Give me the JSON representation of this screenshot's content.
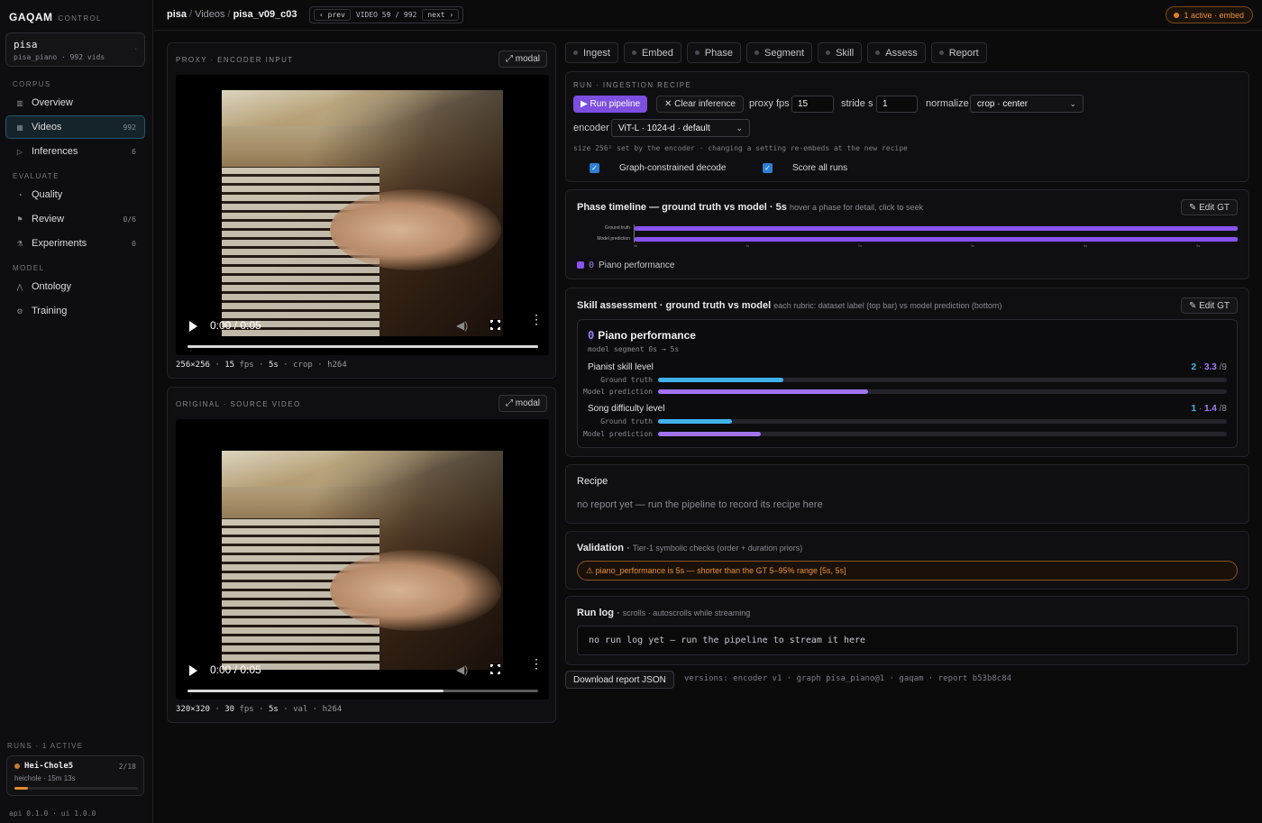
{
  "app": {
    "brand": "GAQAM",
    "brand_sub": "CONTROL"
  },
  "project": {
    "name": "pisa",
    "sub": "pisa_piano · 992 vids",
    "menu_glyph": "·"
  },
  "sidebar": {
    "sections": [
      {
        "title": "CORPUS",
        "items": [
          {
            "label": "Overview",
            "icon": "▥",
            "count": ""
          },
          {
            "label": "Videos",
            "icon": "▦",
            "count": "992"
          },
          {
            "label": "Inferences",
            "icon": "▷",
            "count": "6"
          }
        ]
      },
      {
        "title": "EVALUATE",
        "items": [
          {
            "label": "Quality",
            "icon": "◔",
            "count": ""
          },
          {
            "label": "Review",
            "icon": "⚑",
            "count": "0/6"
          },
          {
            "label": "Experiments",
            "icon": "⚗",
            "count": "0"
          }
        ]
      },
      {
        "title": "MODEL",
        "items": [
          {
            "label": "Ontology",
            "icon": "⋀",
            "count": ""
          },
          {
            "label": "Training",
            "icon": "⚙",
            "count": ""
          }
        ]
      }
    ],
    "active_item": "Videos"
  },
  "runs": {
    "title": "RUNS · 1 ACTIVE",
    "items": [
      {
        "name": "Hei-Chole5",
        "count": "2/18",
        "sub": "heichole · 15m 13s",
        "progress": 0.11
      }
    ]
  },
  "footer": {
    "versions": "api 0.1.0 · ui 1.0.0"
  },
  "header": {
    "crumb_root": "pisa",
    "crumb_mid": "Videos",
    "crumb_leaf": "pisa_v09_c03",
    "prev": "‹ prev",
    "position": "VIDEO 59 / 992",
    "next": "next ›",
    "active_badge": "1 active · embed"
  },
  "proxy": {
    "title": "PROXY · ENCODER INPUT",
    "modal": "⤢ modal",
    "time": "0:00 / 0:05",
    "progress": 1.0,
    "meta": {
      "res": "256×256",
      "fps": "15",
      "fps_unit": "fps",
      "dur": "5s",
      "mode": "crop",
      "codec": "h264"
    }
  },
  "original": {
    "title": "ORIGINAL · SOURCE VIDEO",
    "modal": "⤢ modal",
    "time": "0:00 / 0:05",
    "progress": 0.73,
    "meta": {
      "res": "320×320",
      "fps": "30",
      "fps_unit": "fps",
      "dur": "5s",
      "mode": "val",
      "codec": "h264"
    }
  },
  "tabs": [
    "Ingest",
    "Embed",
    "Phase",
    "Segment",
    "Skill",
    "Assess",
    "Report"
  ],
  "recipe": {
    "title": "RUN · INGESTION RECIPE",
    "run_btn": "▶ Run pipeline",
    "clear_btn": "✕ Clear inference",
    "proxy_fps_label": "proxy fps",
    "proxy_fps": "15",
    "stride_label": "stride s",
    "stride": "1",
    "normalize_label": "normalize",
    "normalize": "crop · center",
    "encoder_label": "encoder",
    "encoder": "ViT-L · 1024-d · default",
    "hint": "size 256² set by the encoder · changing a setting re-embeds at the new recipe",
    "check1": "Graph-constrained decode",
    "check2": "Score all runs"
  },
  "timeline": {
    "title": "Phase timeline — ground truth vs model · 5s",
    "note": "hover a phase for detail, click to seek",
    "edit": "✎ Edit GT",
    "rows": [
      "Ground truth",
      "Model prediction"
    ],
    "ticks": [
      "0s",
      "1s",
      "2s",
      "3s",
      "4s",
      "5s"
    ],
    "legend_idx": "0",
    "legend_label": "Piano performance"
  },
  "skill": {
    "title": "Skill assessment · ground truth vs model",
    "note": "each rubric: dataset label (top bar) vs model prediction (bottom)",
    "edit": "✎ Edit GT",
    "idx": "0",
    "name": "Piano performance",
    "segment": "model segment 0s → 5s",
    "gt_label": "Ground truth",
    "pred_label": "Model prediction",
    "rubrics": [
      {
        "name": "Pianist skill level",
        "gt": "2",
        "pred": "3.3",
        "max": "/9",
        "gt_frac": 0.22,
        "pred_frac": 0.37
      },
      {
        "name": "Song difficulty level",
        "gt": "1",
        "pred": "1.4",
        "max": "/8",
        "gt_frac": 0.13,
        "pred_frac": 0.18
      }
    ],
    "colors": {
      "gt": "#3fb2ec",
      "pred": "#a173f2"
    }
  },
  "recipe_card": {
    "title": "Recipe",
    "empty": "no report yet — run the pipeline to record its recipe here"
  },
  "validation": {
    "title": "Validation",
    "note": "Tier-1 symbolic checks (order + duration priors)",
    "warning": "⚠ piano_performance is 5s — shorter than the GT 5–95% range [5s, 5s]"
  },
  "runlog": {
    "title": "Run log",
    "note": "scrolls · autoscrolls while streaming",
    "empty": "no run log yet — run the pipeline to stream it here"
  },
  "report": {
    "download": "Download report JSON",
    "versions": "versions: encoder v1 · graph pisa_piano@1 · gaqam · report b53b8c84"
  }
}
